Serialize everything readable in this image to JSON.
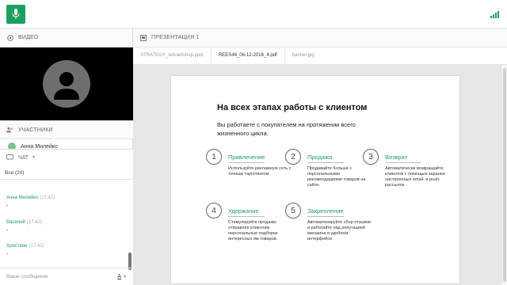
{
  "colors": {
    "accent": "#1d9f5f"
  },
  "topbar": {
    "mic_icon": "microphone-icon",
    "signal_icon": "signal-strength-icon"
  },
  "video": {
    "header": "ВИДЕО"
  },
  "participants": {
    "header": "УЧАСТНИКИ",
    "items": [
      {
        "name": "Анна Милейко"
      }
    ]
  },
  "chat": {
    "header": "ЧАТ",
    "filter": "Все (20)",
    "messages": [
      {
        "author": "Анна Милейко",
        "time": "(17:42)",
        "text": "-"
      },
      {
        "author": "Василий",
        "time": "(17:42)",
        "text": "-"
      },
      {
        "author": "Христине",
        "time": "(17:42)",
        "text": "-"
      }
    ],
    "input_placeholder": "Ваше сообщение"
  },
  "presentation": {
    "header": "ПРЕЗЕНТАЦИЯ 1",
    "tabs": [
      {
        "label": "STRATEGY_Advantshop.pptx",
        "active": false
      },
      {
        "label": "REES46_06-12-2016_4.pdf",
        "active": true
      },
      {
        "label": "banner.jpg",
        "active": false
      }
    ]
  },
  "slide": {
    "title": "На всех этапах работы с клиентом",
    "subtitle": "Вы работаете с покупателем на протяжении всего жизненного цикла.",
    "steps": [
      {
        "num": "1",
        "title": "Привлечение",
        "desc": "Используйте рекламную сеть с точным таргетингом."
      },
      {
        "num": "2",
        "title": "Продажа",
        "desc": "Продавайте больше с персональными рекомендациями товаров на сайте."
      },
      {
        "num": "3",
        "title": "Возврат",
        "desc": "Автоматически возвращайте клиентов с помощью заранее настроенных email- и push-рассылок."
      },
      {
        "num": "4",
        "title": "Удержание",
        "desc": "Стимулируйте продажи, отправляя клиентам персональные подборки интересных им товаров."
      },
      {
        "num": "5",
        "title": "Закрепление",
        "desc": "Автоматизируйте сбор отзывов и работайте над репутацией магазина в удобном интерфейсе."
      }
    ]
  }
}
